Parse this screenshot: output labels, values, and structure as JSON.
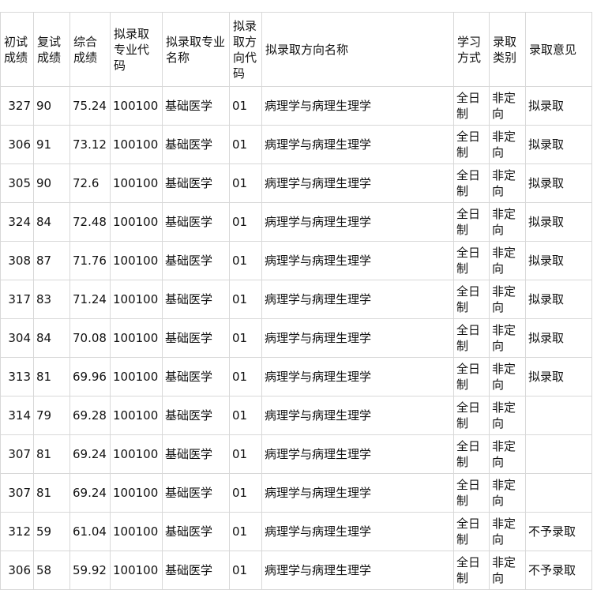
{
  "table": {
    "headers": [
      "初试成绩",
      "复试成绩",
      "综合成绩",
      "拟录取专业代码",
      "拟录取专业名称",
      "拟录取方向代码",
      "拟录取方向名称",
      "学习方式",
      "录取类别",
      "录取意见"
    ],
    "rows": [
      [
        "327",
        "90",
        "75.24",
        "100100",
        "基础医学",
        "01",
        "病理学与病理生理学",
        "全日制",
        "非定向",
        "拟录取"
      ],
      [
        "306",
        "91",
        "73.12",
        "100100",
        "基础医学",
        "01",
        "病理学与病理生理学",
        "全日制",
        "非定向",
        "拟录取"
      ],
      [
        "305",
        "90",
        "72.6",
        "100100",
        "基础医学",
        "01",
        "病理学与病理生理学",
        "全日制",
        "非定向",
        "拟录取"
      ],
      [
        "324",
        "84",
        "72.48",
        "100100",
        "基础医学",
        "01",
        "病理学与病理生理学",
        "全日制",
        "非定向",
        "拟录取"
      ],
      [
        "308",
        "87",
        "71.76",
        "100100",
        "基础医学",
        "01",
        "病理学与病理生理学",
        "全日制",
        "非定向",
        "拟录取"
      ],
      [
        "317",
        "83",
        "71.24",
        "100100",
        "基础医学",
        "01",
        "病理学与病理生理学",
        "全日制",
        "非定向",
        "拟录取"
      ],
      [
        "304",
        "84",
        "70.08",
        "100100",
        "基础医学",
        "01",
        "病理学与病理生理学",
        "全日制",
        "非定向",
        "拟录取"
      ],
      [
        "313",
        "81",
        "69.96",
        "100100",
        "基础医学",
        "01",
        "病理学与病理生理学",
        "全日制",
        "非定向",
        "拟录取"
      ],
      [
        "314",
        "79",
        "69.28",
        "100100",
        "基础医学",
        "01",
        "病理学与病理生理学",
        "全日制",
        "非定向",
        ""
      ],
      [
        "307",
        "81",
        "69.24",
        "100100",
        "基础医学",
        "01",
        "病理学与病理生理学",
        "全日制",
        "非定向",
        ""
      ],
      [
        "307",
        "81",
        "69.24",
        "100100",
        "基础医学",
        "01",
        "病理学与病理生理学",
        "全日制",
        "非定向",
        ""
      ],
      [
        "312",
        "59",
        "61.04",
        "100100",
        "基础医学",
        "01",
        "病理学与病理生理学",
        "全日制",
        "非定向",
        "不予录取"
      ],
      [
        "306",
        "58",
        "59.92",
        "100100",
        "基础医学",
        "01",
        "病理学与病理生理学",
        "全日制",
        "非定向",
        "不予录取"
      ]
    ]
  }
}
